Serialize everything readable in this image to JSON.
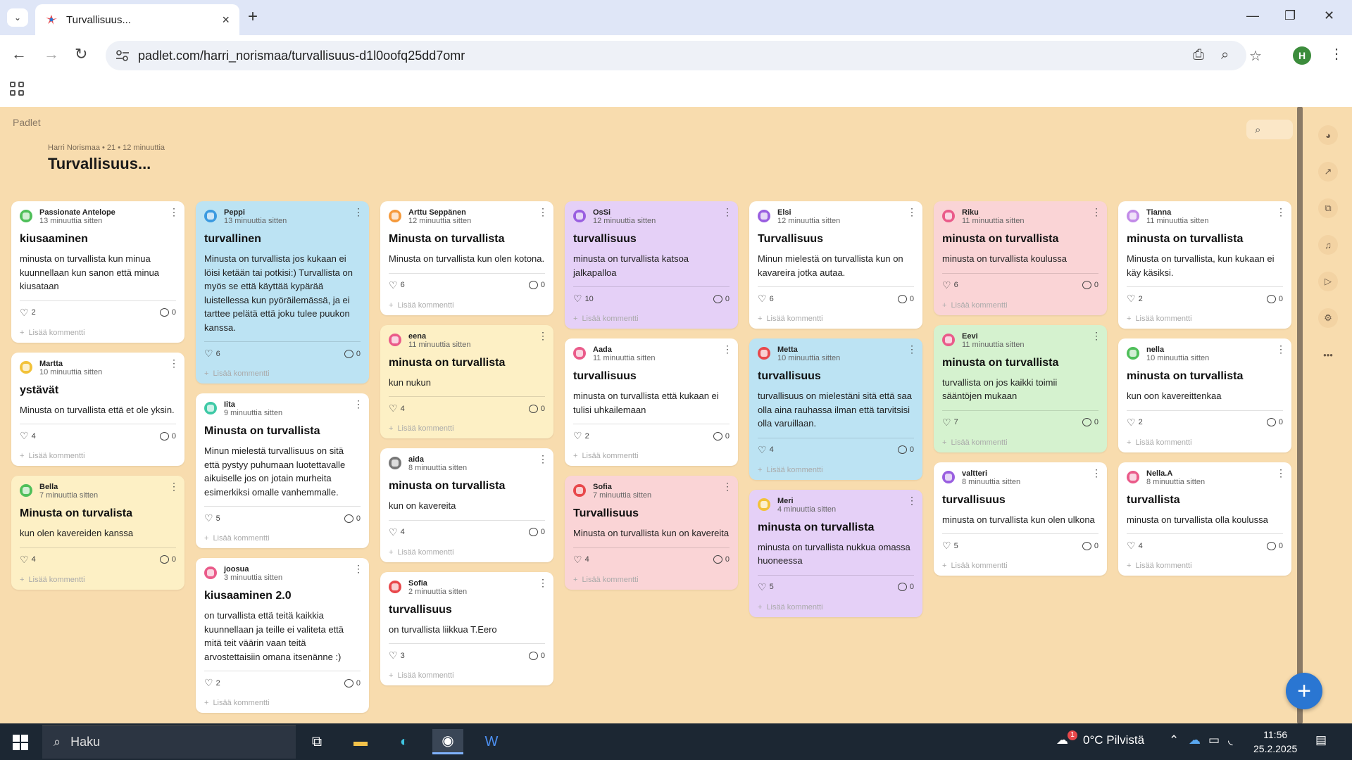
{
  "browser": {
    "tab_title": "Turvallisuus...",
    "tab_close": "×",
    "new_tab": "+",
    "url": "padlet.com/harri_norismaa/turvallisuus-d1l0oofq25dd7omr",
    "profile_initial": "H"
  },
  "board": {
    "brand": "Padlet",
    "meta": "Harri Norismaa • 21 • 12 minuuttia",
    "title": "Turvallisuus...",
    "fab": "+"
  },
  "colors": {
    "white": "#ffffff",
    "blue": "#bce3f3",
    "yellow": "#fdf0c5",
    "purple": "#e5d0f7",
    "pink": "#fad4d6",
    "green": "#d5f2cf"
  },
  "add_comment": "Lisää kommentti",
  "columns": [
    [
      {
        "name": "Passionate Antelope",
        "time": "13 minuuttia sitten",
        "title": "kiusaaminen",
        "body": "minusta on turvallista kun minua kuunnellaan kun sanon että minua kiusataan",
        "likes": "2",
        "comments": "0",
        "color": "white",
        "avatar": "#4fbf5a"
      },
      {
        "name": "Martta",
        "time": "10 minuuttia sitten",
        "title": "ystävät",
        "body": "Minusta on turvallista että et ole yksin.",
        "likes": "4",
        "comments": "0",
        "color": "white",
        "avatar": "#f2c23a"
      },
      {
        "name": "Bella",
        "time": "7 minuuttia sitten",
        "title": "Minusta on turvalista",
        "body": "kun olen kavereiden kanssa",
        "likes": "4",
        "comments": "0",
        "color": "yellow",
        "avatar": "#4fbf5a"
      }
    ],
    [
      {
        "name": "Peppi",
        "time": "13 minuuttia sitten",
        "title": "turvallinen",
        "body": "Minusta on turvallista jos kukaan ei löisi ketään tai potkisi:) Turvallista on myös se että käyttää kypärää luistellessa kun pyöräilemässä, ja ei tarttee pelätä että joku tulee puukon kanssa.",
        "likes": "6",
        "comments": "0",
        "color": "blue",
        "avatar": "#3b9ae0"
      },
      {
        "name": "Iita",
        "time": "9 minuuttia sitten",
        "title": "Minusta on turvallista",
        "body": "Minun mielestä turvallisuus on sitä että pystyy puhumaan luotettavalle aikuiselle jos on jotain murheita esimerkiksi omalle vanhemmalle.",
        "likes": "5",
        "comments": "0",
        "color": "white",
        "avatar": "#3ec9a6"
      },
      {
        "name": "joosua",
        "time": "3 minuuttia sitten",
        "title": "kiusaaminen 2.0",
        "body": "on turvallista että teitä kaikkia kuunnellaan ja teille ei valiteta että mitä teit väärin vaan teitä arvostettaisiin omana itsenänne :)",
        "likes": "2",
        "comments": "0",
        "color": "white",
        "avatar": "#ea5b8a"
      }
    ],
    [
      {
        "name": "Arttu Seppänen",
        "time": "12 minuuttia sitten",
        "title": "Minusta on turvallista",
        "body": " Minusta on turvallista kun olen kotona.",
        "likes": "6",
        "comments": "0",
        "color": "white",
        "avatar": "#f59a3c"
      },
      {
        "name": "eena",
        "time": "11 minuuttia sitten",
        "title": "minusta on turvallista",
        "body": "kun nukun",
        "likes": "4",
        "comments": "0",
        "color": "yellow",
        "avatar": "#ea5b8a"
      },
      {
        "name": "aida",
        "time": "8 minuuttia sitten",
        "title": "minusta on turvallista",
        "body": "kun on kavereita",
        "likes": "4",
        "comments": "0",
        "color": "white",
        "avatar": "#777777"
      },
      {
        "name": "Sofia",
        "time": "2 minuuttia sitten",
        "title": "turvallisuus",
        "body": "on turvallista liikkua T.Eero",
        "likes": "3",
        "comments": "0",
        "color": "white",
        "avatar": "#e8484b"
      }
    ],
    [
      {
        "name": "OsSi",
        "time": "12 minuuttia sitten",
        "title": "turvallisuus",
        "body": "minusta on turvallista katsoa jalkapalloa",
        "likes": "10",
        "comments": "0",
        "color": "purple",
        "avatar": "#9a5fe0"
      },
      {
        "name": "Aada",
        "time": "11 minuuttia sitten",
        "title": "turvallisuus",
        "body": "minusta on turvallista että kukaan ei tulisi uhkailemaan",
        "likes": "2",
        "comments": "0",
        "color": "white",
        "avatar": "#ea5b8a"
      },
      {
        "name": "Sofia",
        "time": "7 minuuttia sitten",
        "title": "Turvallisuus",
        "body": "Minusta on turvallista kun on kavereita",
        "likes": "4",
        "comments": "0",
        "color": "pink",
        "avatar": "#e8484b"
      }
    ],
    [
      {
        "name": "Elsi",
        "time": "12 minuuttia sitten",
        "title": "Turvallisuus",
        "body": "Minun mielestä on turvallista kun on kavareira jotka autaa.",
        "likes": "6",
        "comments": "0",
        "color": "white",
        "avatar": "#9a5fe0"
      },
      {
        "name": "Metta",
        "time": "10 minuuttia sitten",
        "title": "turvallisuus",
        "body": "turvallisuus on mielestäni sitä että saa olla aina rauhassa ilman että tarvitsisi olla varuillaan.",
        "likes": "4",
        "comments": "0",
        "color": "blue",
        "avatar": "#e8484b"
      },
      {
        "name": "Meri",
        "time": "4 minuuttia sitten",
        "title": "minusta on turvallista",
        "body": "minusta on turvallista nukkua omassa huoneessa",
        "likes": "5",
        "comments": "0",
        "color": "purple",
        "avatar": "#f2c23a"
      }
    ],
    [
      {
        "name": "Riku",
        "time": "11 minuuttia sitten",
        "title": "minusta on turvallista",
        "body": "minusta on turvallista koulussa",
        "likes": "6",
        "comments": "0",
        "color": "pink",
        "avatar": "#ea5b8a"
      },
      {
        "name": "Eevi",
        "time": "11 minuuttia sitten",
        "title": "minusta on turvallista",
        "body": "turvallista on jos kaikki toimii sääntöjen mukaan",
        "likes": "7",
        "comments": "0",
        "color": "green",
        "avatar": "#ea5b8a"
      },
      {
        "name": "valtteri",
        "time": "8 minuuttia sitten",
        "title": "turvallisuus",
        "body": "minusta on turvallista kun olen ulkona",
        "likes": "5",
        "comments": "0",
        "color": "white",
        "avatar": "#9a5fe0"
      }
    ],
    [
      {
        "name": "Tianna",
        "time": "11 minuuttia sitten",
        "title": "minusta on turvallista",
        "body": "Minusta on turvallista, kun kukaan ei käy käsiksi.",
        "likes": "2",
        "comments": "0",
        "color": "white",
        "avatar": "#c28be8"
      },
      {
        "name": "nella",
        "time": "10 minuuttia sitten",
        "title": "minusta on turvallista",
        "body": "kun oon kavereittenkaa",
        "likes": "2",
        "comments": "0",
        "color": "white",
        "avatar": "#4fbf5a"
      },
      {
        "name": "Nella.A",
        "time": "8 minuuttia sitten",
        "title": "turvallista",
        "body": "minusta on turvallista olla koulussa",
        "likes": "4",
        "comments": "0",
        "color": "white",
        "avatar": "#ea5b8a"
      }
    ]
  ],
  "taskbar": {
    "search": "Haku",
    "weather": "0°C  Pilvistä",
    "time": "11:56",
    "date": "25.2.2025",
    "badge": "1"
  }
}
